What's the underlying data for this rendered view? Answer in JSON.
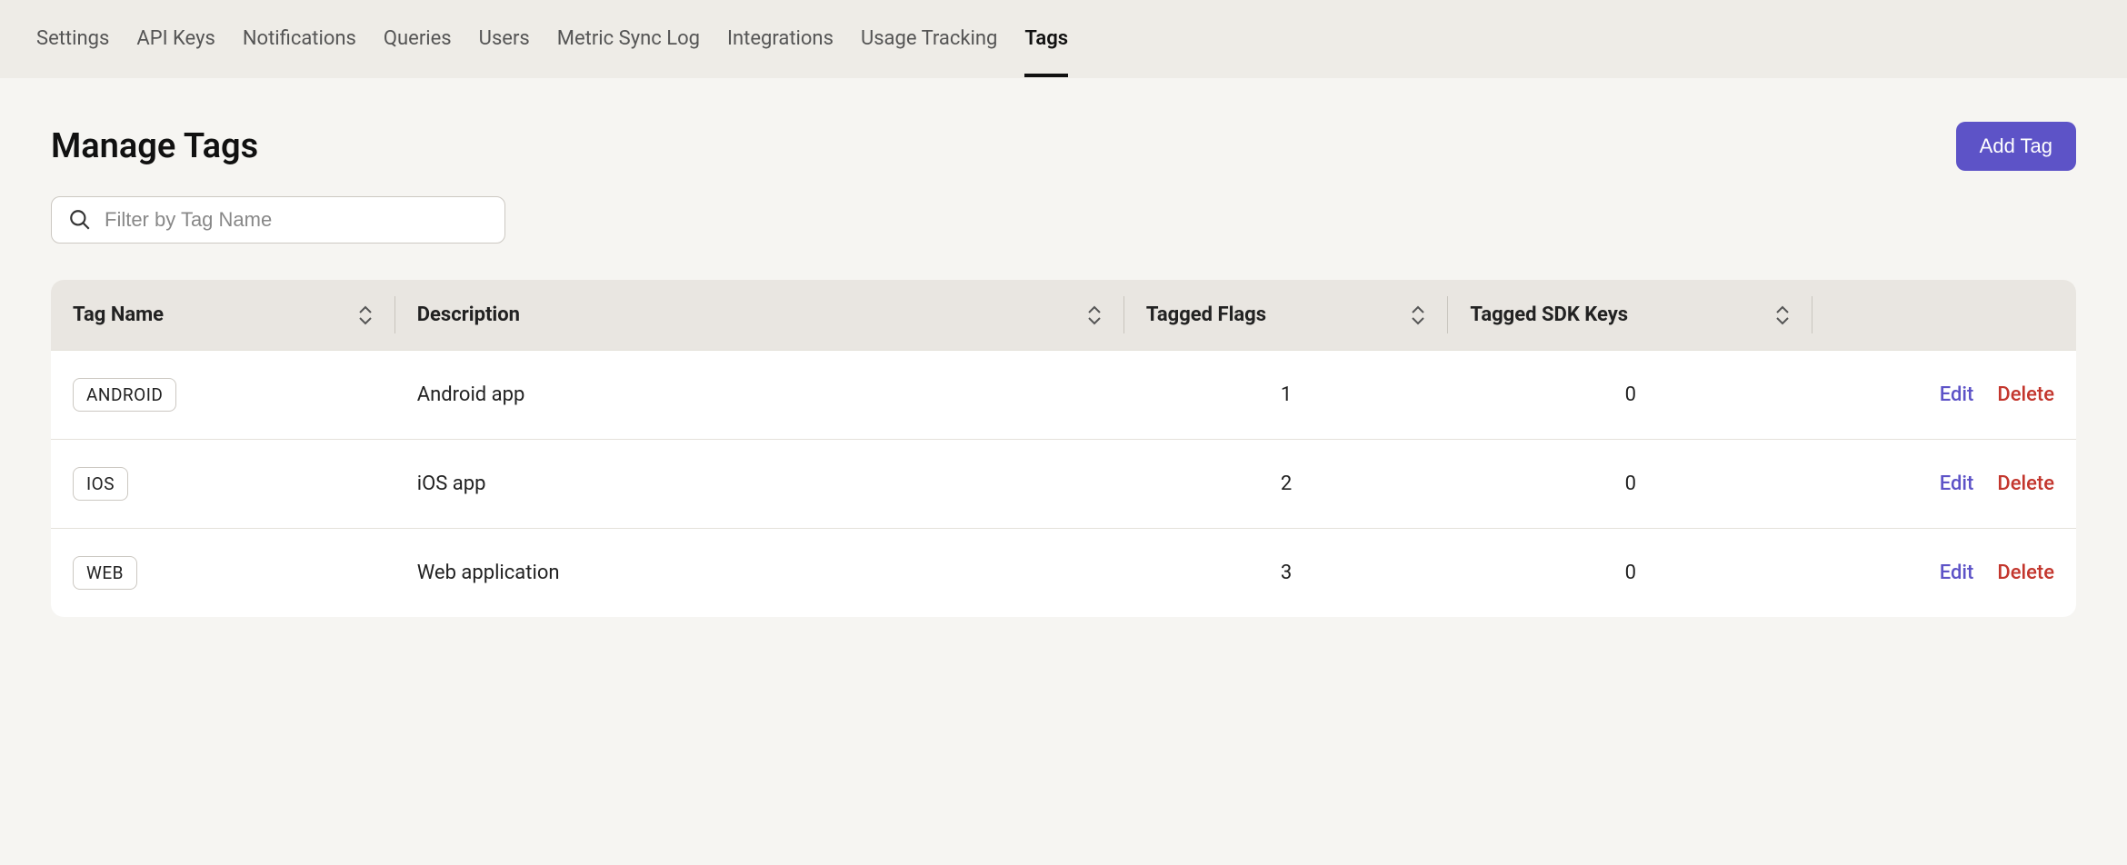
{
  "nav": {
    "items": [
      {
        "label": "Settings",
        "active": false
      },
      {
        "label": "API Keys",
        "active": false
      },
      {
        "label": "Notifications",
        "active": false
      },
      {
        "label": "Queries",
        "active": false
      },
      {
        "label": "Users",
        "active": false
      },
      {
        "label": "Metric Sync Log",
        "active": false
      },
      {
        "label": "Integrations",
        "active": false
      },
      {
        "label": "Usage Tracking",
        "active": false
      },
      {
        "label": "Tags",
        "active": true
      }
    ]
  },
  "header": {
    "title": "Manage Tags",
    "add_button": "Add Tag"
  },
  "filter": {
    "placeholder": "Filter by Tag Name",
    "value": ""
  },
  "table": {
    "columns": {
      "name": "Tag Name",
      "description": "Description",
      "flags": "Tagged Flags",
      "sdk": "Tagged SDK Keys"
    },
    "actions": {
      "edit": "Edit",
      "delete": "Delete"
    },
    "rows": [
      {
        "tag": "ANDROID",
        "description": "Android app",
        "flags": "1",
        "sdk": "0"
      },
      {
        "tag": "IOS",
        "description": "iOS app",
        "flags": "2",
        "sdk": "0"
      },
      {
        "tag": "WEB",
        "description": "Web application",
        "flags": "3",
        "sdk": "0"
      }
    ]
  }
}
